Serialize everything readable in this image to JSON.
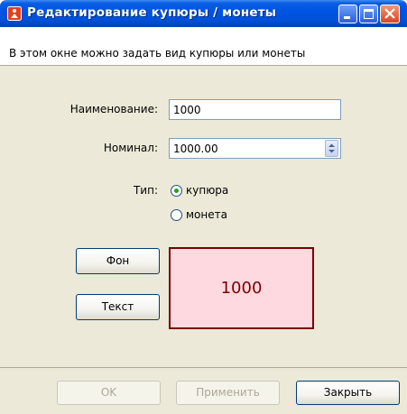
{
  "window": {
    "title": "Редактирование купюры / монеты",
    "description": "В этом окне можно задать вид купюры или монеты"
  },
  "form": {
    "name_label": "Наименование:",
    "name_value": "1000",
    "nominal_label": "Номинал:",
    "nominal_value": "1000.00",
    "type_label": "Тип:",
    "type_options": [
      {
        "label": "купюра",
        "selected": true
      },
      {
        "label": "монета",
        "selected": false
      }
    ]
  },
  "style_buttons": {
    "background_label": "Фон",
    "text_label": "Текст"
  },
  "preview": {
    "text": "1000",
    "background_color": "#ffd9e0",
    "text_color": "#7a0000",
    "border_color": "#7a0000"
  },
  "footer": {
    "ok_label": "OK",
    "apply_label": "Применить",
    "close_label": "Закрыть"
  }
}
